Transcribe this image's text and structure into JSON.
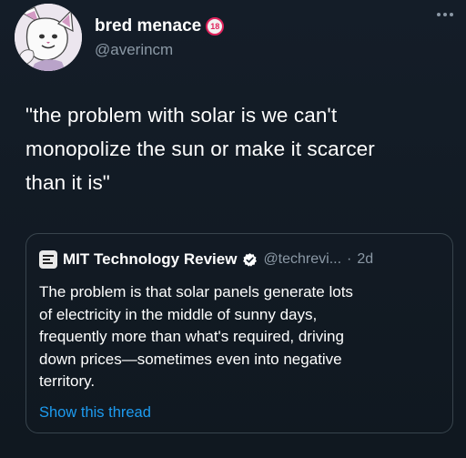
{
  "author": {
    "display_name": "bred menace",
    "badge": "18",
    "handle": "@averincm"
  },
  "tweet": {
    "lines": [
      "\"the problem with solar is we can't",
      "monopolize the sun or make it scarcer",
      "than it is\""
    ]
  },
  "quote": {
    "name": "MIT Technology Review",
    "handle": "@techrevi...",
    "separator": "·",
    "time": "2d",
    "lines": [
      "The problem is that solar panels generate lots",
      "of electricity in the middle of sunny days,",
      "frequently more than what's required, driving",
      "down prices—sometimes even into negative",
      "territory."
    ],
    "show_thread": "Show this thread"
  },
  "colors": {
    "background": "#15202b",
    "text": "#ffffff",
    "secondary": "#8b98a5",
    "link": "#1d9bf0",
    "border": "#38444d",
    "badge_red": "#e0245e"
  },
  "icons": {
    "more": "more-horizontal-icon",
    "verified": "verified-badge-icon",
    "age_badge": "age-restriction-badge",
    "quote_logo": "mit-technology-review-logo"
  }
}
